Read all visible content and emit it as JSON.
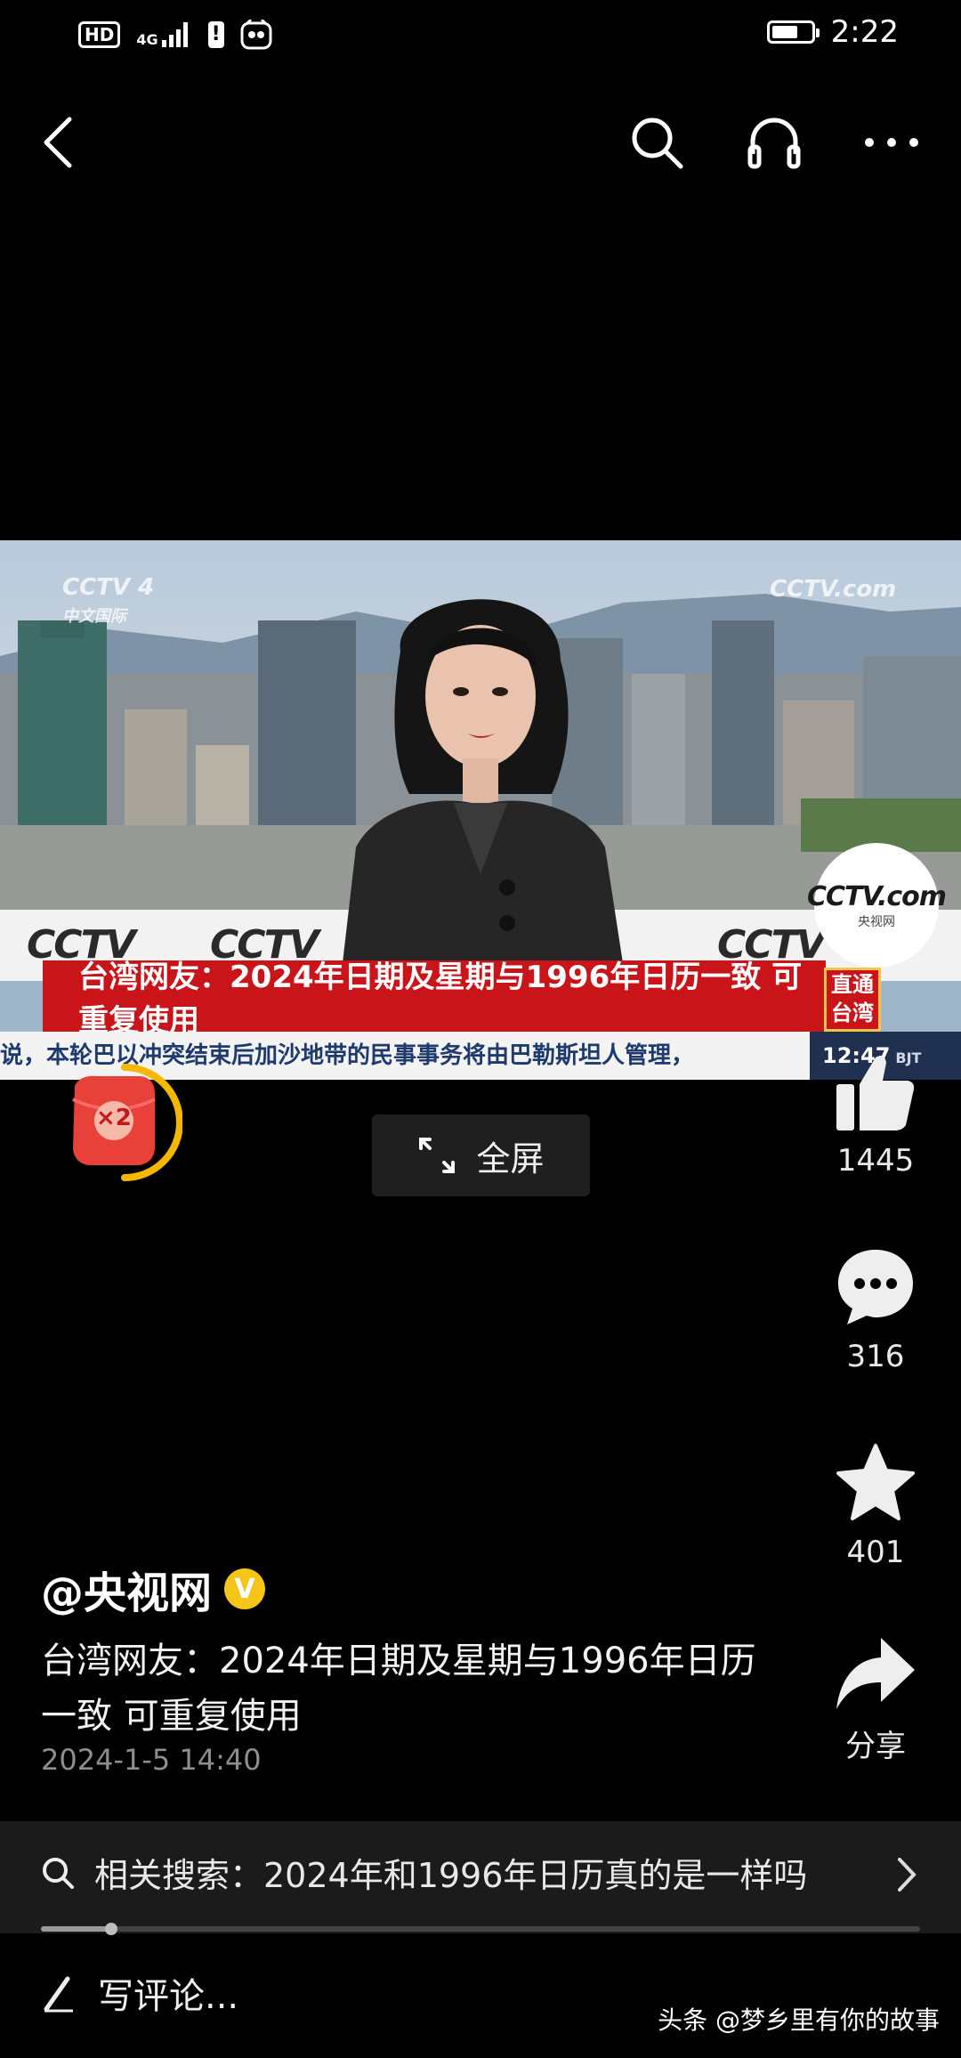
{
  "status_bar": {
    "hd_label": "HD",
    "network_label": "4G",
    "time": "2:22"
  },
  "top_nav": {
    "icons": [
      "back-arrow-icon",
      "search-icon",
      "headphones-icon",
      "more-icon"
    ]
  },
  "video": {
    "headline": "台湾网友：2024年日期及星期与1996年日历一致 可重复使用",
    "ticker": "说，本轮巴以冲突结束后加沙地带的民事事务将由巴勒斯坦人管理，",
    "channel_tag": "直通台湾",
    "clock_time": "12:47",
    "clock_zone": "BJT",
    "watermark_channel": "CCTV 4",
    "watermark_sub": "中文国际",
    "watermark_site": "CCTV.com",
    "logo_text": "CCTV.com",
    "logo_sub": "央视网",
    "cctv_mark": "CCTV"
  },
  "red_packet": {
    "multiplier": "×2"
  },
  "fullscreen_button": {
    "label": "全屏"
  },
  "actions": {
    "like_count": "1445",
    "comment_count": "316",
    "favorite_count": "401",
    "share_label": "分享"
  },
  "post": {
    "author": "@央视网",
    "verified_badge": "V",
    "description": "台湾网友：2024年日期及星期与1996年日历一致 可重复使用",
    "date": "2024-1-5 14:40"
  },
  "related_search": {
    "text": "相关搜索：2024年和1996年日历真的是一样吗",
    "progress": 0.08
  },
  "comment_box": {
    "placeholder": "写评论..."
  },
  "credit": "头条 @梦乡里有你的故事",
  "colors": {
    "background": "#000000",
    "headline_red": "#c9141a",
    "verified_yellow": "#f5c518",
    "red_packet_ring": "#f5b700"
  }
}
